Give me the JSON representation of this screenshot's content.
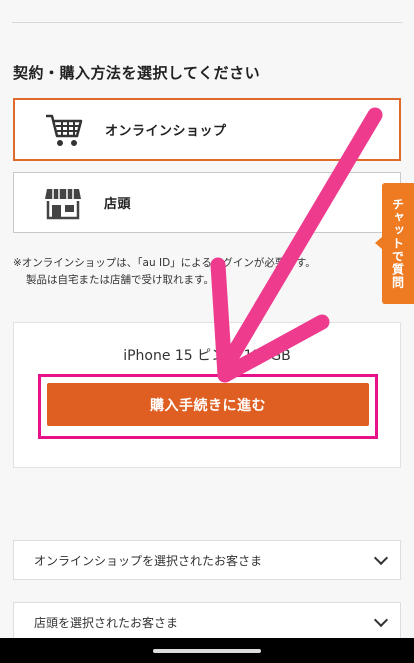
{
  "heading": "契約・購入方法を選択してください",
  "options": [
    {
      "label": "オンラインショップ",
      "icon": "cart-icon"
    },
    {
      "label": "店頭",
      "icon": "store-icon"
    }
  ],
  "note": {
    "line1": "※オンラインショップは、「au ID」によるログインが必要です。",
    "line2": "製品は自宅または店舗で受け取れます。"
  },
  "product": {
    "name": "iPhone 15 ピンク 128GB",
    "cta_label": "購入手続きに進む"
  },
  "accordions": [
    {
      "label": "オンラインショップを選択されたお客さま"
    },
    {
      "label": "店頭を選択されたお客さま"
    }
  ],
  "chat_label": "チャットで質問",
  "colors": {
    "accent": "#df5f22",
    "highlight": "#e8118a",
    "arrow": "#ee3b8e"
  }
}
